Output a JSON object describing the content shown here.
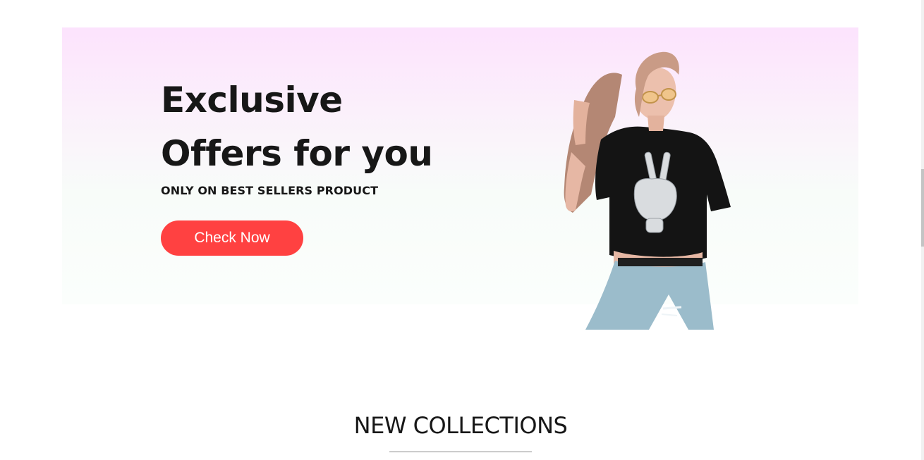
{
  "offer": {
    "headline_line1": "Exclusive",
    "headline_line2": "Offers for you",
    "subheading": "ONLY ON BEST SELLERS PRODUCT",
    "cta_label": "Check Now",
    "hero_image": "model-in-skeleton-peace-sign-tee-and-jeans"
  },
  "section": {
    "title": "NEW COLLECTIONS"
  },
  "colors": {
    "accent": "#ff4141",
    "banner_top": "#fce3fd",
    "banner_bottom": "#fbfefc",
    "text": "#171717"
  }
}
